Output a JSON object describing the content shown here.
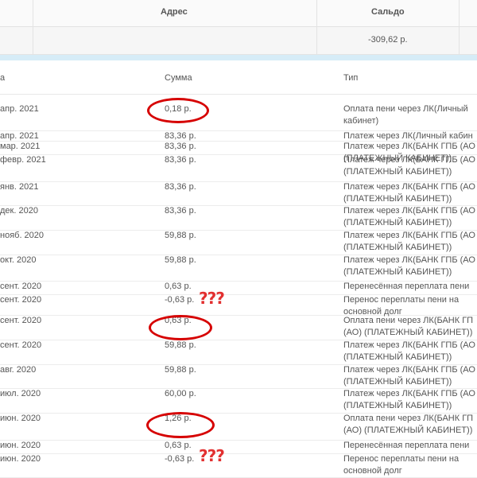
{
  "top_table": {
    "col_address": "Адрес",
    "col_balance": "Сальдо",
    "balance_value": "-309,62 р."
  },
  "history": {
    "col_date": "а",
    "col_sum": "Сумма",
    "col_type": "Тип",
    "rows": [
      {
        "date": "апр. 2021",
        "sum": "0,18 р.",
        "type": [
          "Оплата пени через ЛК(Личный",
          "кабинет)"
        ]
      },
      {
        "date": "апр. 2021",
        "sum": "83,36 р.",
        "type": [
          "Платеж через ЛК(Личный кабин"
        ]
      },
      {
        "date": "мар. 2021",
        "sum": "83,36 р.",
        "type": [
          "Платеж через ЛК(БАНК ГПБ (АО",
          "(ПЛАТЕЖНЫЙ КАБИНЕТ))"
        ]
      },
      {
        "date": "февр. 2021",
        "sum": "83,36 р.",
        "type": [
          "Платеж через ЛК(БАНК ГПБ (АО",
          "(ПЛАТЕЖНЫЙ КАБИНЕТ))"
        ]
      },
      {
        "date": "янв. 2021",
        "sum": "83,36 р.",
        "type": [
          "Платеж через ЛК(БАНК ГПБ (АО",
          "(ПЛАТЕЖНЫЙ КАБИНЕТ))"
        ]
      },
      {
        "date": "дек. 2020",
        "sum": "83,36 р.",
        "type": [
          "Платеж через ЛК(БАНК ГПБ (АО",
          "(ПЛАТЕЖНЫЙ КАБИНЕТ))"
        ]
      },
      {
        "date": "нояб. 2020",
        "sum": "59,88 р.",
        "type": [
          "Платеж через ЛК(БАНК ГПБ (АО",
          "(ПЛАТЕЖНЫЙ КАБИНЕТ))"
        ]
      },
      {
        "date": "окт. 2020",
        "sum": "59,88 р.",
        "type": [
          "Платеж через ЛК(БАНК ГПБ (АО",
          "(ПЛАТЕЖНЫЙ КАБИНЕТ))"
        ]
      },
      {
        "date": "сент. 2020",
        "sum": "0,63 р.",
        "type": [
          "Перенесённая переплата пени"
        ]
      },
      {
        "date": "сент. 2020",
        "sum": "-0,63 р.",
        "type": [
          "Перенос переплаты пени на",
          "основной долг"
        ]
      },
      {
        "date": "сент. 2020",
        "sum": "0,63 р.",
        "type": [
          "Оплата пени через ЛК(БАНК ГП",
          "(АО) (ПЛАТЕЖНЫЙ КАБИНЕТ))"
        ]
      },
      {
        "date": "сент. 2020",
        "sum": "59,88 р.",
        "type": [
          "Платеж через ЛК(БАНК ГПБ (АО",
          "(ПЛАТЕЖНЫЙ КАБИНЕТ))"
        ]
      },
      {
        "date": "авг. 2020",
        "sum": "59,88 р.",
        "type": [
          "Платеж через ЛК(БАНК ГПБ (АО",
          "(ПЛАТЕЖНЫЙ КАБИНЕТ))"
        ]
      },
      {
        "date": "июл. 2020",
        "sum": "60,00 р.",
        "type": [
          "Платеж через ЛК(БАНК ГПБ (АО",
          "(ПЛАТЕЖНЫЙ КАБИНЕТ))"
        ]
      },
      {
        "date": "июн. 2020",
        "sum": "1,26 р.",
        "type": [
          "Оплата пени через ЛК(БАНК ГП",
          "(АО) (ПЛАТЕЖНЫЙ КАБИНЕТ))"
        ]
      },
      {
        "date": "июн. 2020",
        "sum": "0,63 р.",
        "type": [
          "Перенесённая переплата пени"
        ]
      },
      {
        "date": "июн. 2020",
        "sum": "-0,63 р.",
        "type": [
          "Перенос переплаты пени на",
          "основной долг"
        ]
      }
    ]
  },
  "annotations": {
    "question_marks": "???",
    "annotation_color": "#d60000"
  }
}
